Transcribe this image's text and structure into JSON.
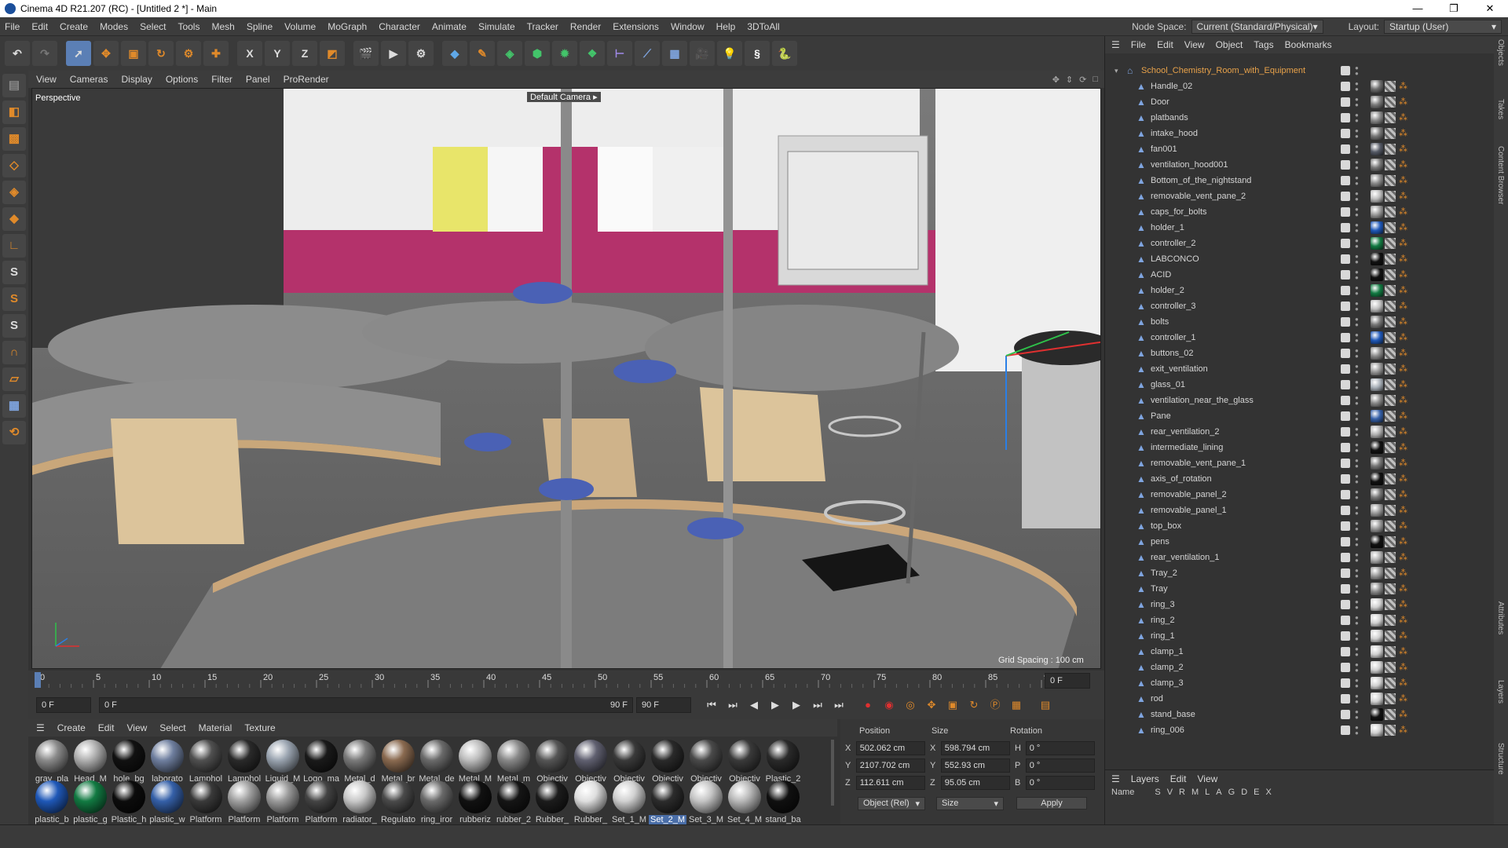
{
  "window": {
    "title": "Cinema 4D R21.207 (RC) - [Untitled 2 *] - Main",
    "controls": [
      "—",
      "❐",
      "✕"
    ]
  },
  "menubar": {
    "items": [
      "File",
      "Edit",
      "Create",
      "Modes",
      "Select",
      "Tools",
      "Mesh",
      "Spline",
      "Volume",
      "MoGraph",
      "Character",
      "Animate",
      "Simulate",
      "Tracker",
      "Render",
      "Extensions",
      "Window",
      "Help",
      "3DToAll"
    ],
    "node_space_label": "Node Space:",
    "node_space_value": "Current (Standard/Physical)",
    "layout_label": "Layout:",
    "layout_value": "Startup (User)"
  },
  "toolbar": {
    "axis_x": "X",
    "axis_y": "Y",
    "axis_z": "Z"
  },
  "viewport": {
    "menu": [
      "View",
      "Cameras",
      "Display",
      "Options",
      "Filter",
      "Panel",
      "ProRender"
    ],
    "view_name": "Perspective",
    "camera_label": "Default Camera",
    "grid_spacing": "Grid Spacing : 100 cm"
  },
  "timeline": {
    "ticks": [
      "0",
      "5",
      "10",
      "15",
      "20",
      "25",
      "30",
      "35",
      "40",
      "45",
      "50",
      "55",
      "60",
      "65",
      "70",
      "75",
      "80",
      "85",
      "90"
    ],
    "current_frame": "0 F"
  },
  "transport": {
    "start": "0 F",
    "current": "0 F",
    "end_a": "90 F",
    "end_b": "90 F"
  },
  "materials": {
    "menu": [
      "Create",
      "Edit",
      "View",
      "Select",
      "Material",
      "Texture"
    ],
    "row1": [
      {
        "name": "gray_pla",
        "color": "#8a8a8a"
      },
      {
        "name": "Head_M",
        "color": "#b0b0b0"
      },
      {
        "name": "hole_bg",
        "color": "#111111"
      },
      {
        "name": "laborato",
        "color": "#6f7f9f"
      },
      {
        "name": "Lamphol",
        "color": "#505050"
      },
      {
        "name": "Lamphol",
        "color": "#2a2a2a"
      },
      {
        "name": "Liquid_M",
        "color": "#9aa4b0"
      },
      {
        "name": "Logo_ma",
        "color": "#1a1a1a"
      },
      {
        "name": "Metal_d",
        "color": "#7a7a7a"
      },
      {
        "name": "Metal_br",
        "color": "#8a6a50"
      },
      {
        "name": "Metal_de",
        "color": "#6a6a6a"
      },
      {
        "name": "Metal_M",
        "color": "#bdbdbd"
      },
      {
        "name": "Metal_m",
        "color": "#888888"
      },
      {
        "name": "Objectiv",
        "color": "#555555"
      },
      {
        "name": "Objectiv",
        "color": "#606070"
      },
      {
        "name": "Objectiv",
        "color": "#3a3a3a"
      },
      {
        "name": "Objectiv",
        "color": "#2a2a2a"
      },
      {
        "name": "Objectiv",
        "color": "#4a4a4a"
      },
      {
        "name": "Objectiv",
        "color": "#3a3a3a"
      },
      {
        "name": "Plastic_2",
        "color": "#2a2a2a"
      }
    ],
    "row2": [
      {
        "name": "plastic_b",
        "color": "#1f58b8"
      },
      {
        "name": "plastic_g",
        "color": "#127a42"
      },
      {
        "name": "Plastic_h",
        "color": "#0c0c0c"
      },
      {
        "name": "plastic_w",
        "color": "#3560a8"
      },
      {
        "name": "Platform",
        "color": "#3a3a3a"
      },
      {
        "name": "Platform",
        "color": "#a0a0a0"
      },
      {
        "name": "Platform",
        "color": "#9a9a9a"
      },
      {
        "name": "Platform",
        "color": "#444444"
      },
      {
        "name": "radiator_",
        "color": "#c8c8c8"
      },
      {
        "name": "Regulato",
        "color": "#4a4a4a"
      },
      {
        "name": "ring_iror",
        "color": "#6a6a6a"
      },
      {
        "name": "rubberiz",
        "color": "#111111"
      },
      {
        "name": "rubber_2",
        "color": "#151515"
      },
      {
        "name": "Rubber_",
        "color": "#1c1c1c"
      },
      {
        "name": "Rubber_",
        "color": "#dedede"
      },
      {
        "name": "Set_1_M",
        "color": "#d0d0d0"
      },
      {
        "name": "Set_2_M",
        "color": "#2c2c2c"
      },
      {
        "name": "Set_3_M",
        "color": "#c4c4c4"
      },
      {
        "name": "Set_4_M",
        "color": "#b8b8b8"
      },
      {
        "name": "stand_ba",
        "color": "#101010"
      }
    ],
    "selected": "Set_2_M"
  },
  "coords": {
    "headers": [
      "Position",
      "Size",
      "Rotation"
    ],
    "rows": [
      {
        "axis": "X",
        "pos": "502.062 cm",
        "saxis": "X",
        "size": "598.794 cm",
        "raxis": "H",
        "rot": "0 °"
      },
      {
        "axis": "Y",
        "pos": "2107.702 cm",
        "saxis": "Y",
        "size": "552.93 cm",
        "raxis": "P",
        "rot": "0 °"
      },
      {
        "axis": "Z",
        "pos": "112.611 cm",
        "saxis": "Z",
        "size": "95.05 cm",
        "raxis": "B",
        "rot": "0 °"
      }
    ],
    "mode": "Object (Rel)",
    "size_mode": "Size",
    "apply": "Apply"
  },
  "objects": {
    "menu": [
      "File",
      "Edit",
      "View",
      "Object",
      "Tags",
      "Bookmarks"
    ],
    "root": "School_Chemistry_Room_with_Equipment",
    "items": [
      {
        "name": "Handle_02",
        "tag": "#6e6e6e"
      },
      {
        "name": "Door",
        "tag": "#7a7a7a"
      },
      {
        "name": "platbands",
        "tag": "#8a8a8a"
      },
      {
        "name": "intake_hood",
        "tag": "#777777"
      },
      {
        "name": "fan001",
        "tag": "#555a66"
      },
      {
        "name": "ventilation_hood001",
        "tag": "#777777"
      },
      {
        "name": "Bottom_of_the_nightstand",
        "tag": "#8a8a8a"
      },
      {
        "name": "removable_vent_pane_2",
        "tag": "#bdbdbd"
      },
      {
        "name": "caps_for_bolts",
        "tag": "#9a9a9a"
      },
      {
        "name": "holder_1",
        "tag": "#1f58b8"
      },
      {
        "name": "controller_2",
        "tag": "#127a42"
      },
      {
        "name": "LABCONCO",
        "tag": "#111111"
      },
      {
        "name": "ACID",
        "tag": "#111111"
      },
      {
        "name": "holder_2",
        "tag": "#127a42"
      },
      {
        "name": "controller_3",
        "tag": "#c0c0c0"
      },
      {
        "name": "bolts",
        "tag": "#777777"
      },
      {
        "name": "controller_1",
        "tag": "#1f58b8"
      },
      {
        "name": "buttons_02",
        "tag": "#8a8a8a"
      },
      {
        "name": "exit_ventilation",
        "tag": "#999999"
      },
      {
        "name": "glass_01",
        "tag": "#a8b0b8"
      },
      {
        "name": "ventilation_near_the_glass",
        "tag": "#888888"
      },
      {
        "name": "Pane",
        "tag": "#3560a8"
      },
      {
        "name": "rear_ventilation_2",
        "tag": "#b0b0b0"
      },
      {
        "name": "intermediate_lining",
        "tag": "#111111"
      },
      {
        "name": "removable_vent_pane_1",
        "tag": "#777777"
      },
      {
        "name": "axis_of_rotation",
        "tag": "#111111"
      },
      {
        "name": "removable_panel_2",
        "tag": "#777777"
      },
      {
        "name": "removable_panel_1",
        "tag": "#9a9a9a"
      },
      {
        "name": "top_box",
        "tag": "#999999"
      },
      {
        "name": "pens",
        "tag": "#111111"
      },
      {
        "name": "rear_ventilation_1",
        "tag": "#b0b0b0"
      },
      {
        "name": "Tray_2",
        "tag": "#9a9a9a"
      },
      {
        "name": "Tray",
        "tag": "#8a8a8a"
      },
      {
        "name": "ring_3",
        "tag": "#d0d0d0"
      },
      {
        "name": "ring_2",
        "tag": "#d0d0d0"
      },
      {
        "name": "ring_1",
        "tag": "#d0d0d0"
      },
      {
        "name": "clamp_1",
        "tag": "#d0d0d0"
      },
      {
        "name": "clamp_2",
        "tag": "#d0d0d0"
      },
      {
        "name": "clamp_3",
        "tag": "#d0d0d0"
      },
      {
        "name": "rod",
        "tag": "#d0d0d0"
      },
      {
        "name": "stand_base",
        "tag": "#111111"
      },
      {
        "name": "ring_006",
        "tag": "#d0d0d0"
      }
    ]
  },
  "layers": {
    "menu": [
      "Layers",
      "Edit",
      "View"
    ],
    "headers": [
      "Name",
      "S",
      "V",
      "R",
      "M",
      "L",
      "A",
      "G",
      "D",
      "E",
      "X"
    ]
  },
  "sidetabs": [
    "Objects",
    "Takes",
    "Content Browser",
    "Attributes",
    "Layers",
    "Structure"
  ]
}
